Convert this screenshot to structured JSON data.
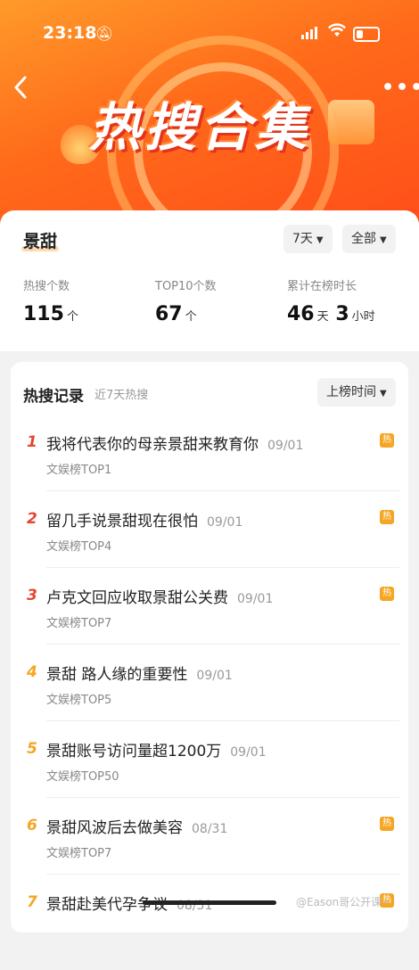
{
  "status": {
    "time": "23:18",
    "mute_icon": "bell-slash-icon",
    "wifi_icon": "wifi-icon"
  },
  "header": {
    "title": "热搜合集",
    "back_icon": "chevron-left-icon",
    "more_icon": "more-dots-icon"
  },
  "summary": {
    "name": "景甜",
    "period_label": "7天",
    "scope_label": "全部",
    "stats": [
      {
        "label": "热搜个数",
        "value": "115",
        "unit": "个"
      },
      {
        "label": "TOP10个数",
        "value": "67",
        "unit": "个"
      },
      {
        "label": "累计在榜时长",
        "value_days": "46",
        "unit_days": "天",
        "value_hours": "3",
        "unit_hours": "小时"
      }
    ]
  },
  "records": {
    "title": "热搜记录",
    "subtitle": "近7天热搜",
    "sort_label": "上榜时间",
    "items": [
      {
        "rank": "1",
        "title": "我将代表你的母亲景甜来教育你",
        "date": "09/01",
        "sub": "文娱榜TOP1",
        "hot": "热"
      },
      {
        "rank": "2",
        "title": "留几手说景甜现在很怕",
        "date": "09/01",
        "sub": "文娱榜TOP4",
        "hot": "热"
      },
      {
        "rank": "3",
        "title": "卢克文回应收取景甜公关费",
        "date": "09/01",
        "sub": "文娱榜TOP7",
        "hot": "热"
      },
      {
        "rank": "4",
        "title": "景甜 路人缘的重要性",
        "date": "09/01",
        "sub": "文娱榜TOP5",
        "hot": ""
      },
      {
        "rank": "5",
        "title": "景甜账号访问量超1200万",
        "date": "09/01",
        "sub": "文娱榜TOP50",
        "hot": ""
      },
      {
        "rank": "6",
        "title": "景甜风波后去做美容",
        "date": "08/31",
        "sub": "文娱榜TOP7",
        "hot": "热"
      },
      {
        "rank": "7",
        "title": "景甜赴美代孕争议",
        "date": "08/31",
        "sub": "",
        "hot": "热"
      }
    ]
  },
  "watermark": "@Eason哥公开课~"
}
